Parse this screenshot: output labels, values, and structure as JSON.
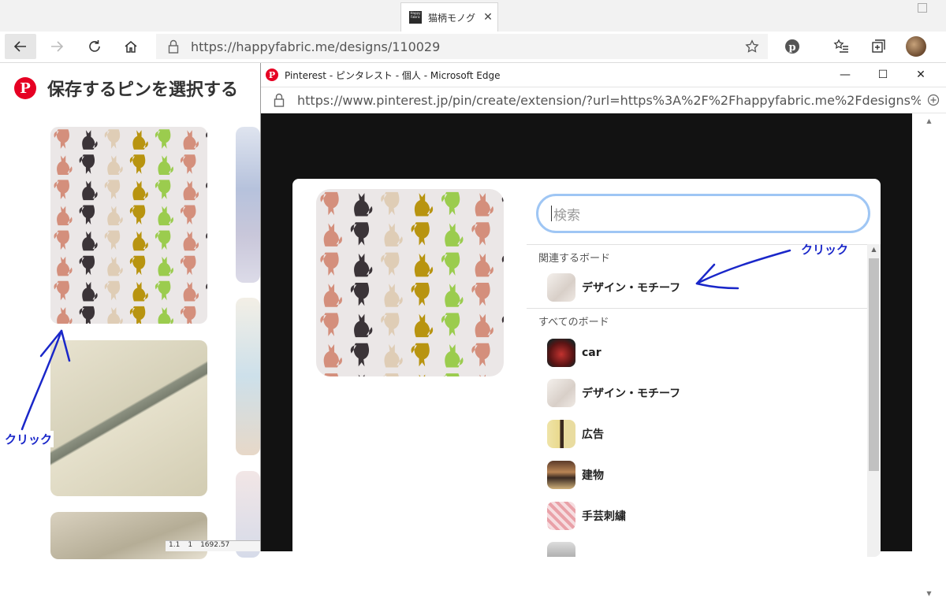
{
  "browser": {
    "tab_title": "猫柄モノグ",
    "tab_favicon_text": "Happy Fabric",
    "address_url": "https://happyfabric.me/designs/110029"
  },
  "background_page": {
    "title": "保存するピンを選択する"
  },
  "popup": {
    "window_title": "Pinterest - ピンタレスト - 個人 - Microsoft Edge",
    "address_url": "https://www.pinterest.jp/pin/create/extension/?url=https%3A%2F%2Fhappyfabric.me%2Fdesigns%2...",
    "search_placeholder": "検索",
    "related_label": "関連するボード",
    "all_label": "すべてのボード",
    "related_boards": [
      {
        "name": "デザイン・モチーフ"
      }
    ],
    "all_boards": [
      {
        "name": "car"
      },
      {
        "name": "デザイン・モチーフ"
      },
      {
        "name": "広告"
      },
      {
        "name": "建物"
      },
      {
        "name": "手芸刺繍"
      }
    ]
  },
  "annotations": {
    "click_left": "クリック",
    "click_right": "クリック",
    "color": "#1a27c9"
  },
  "status_strip": [
    "1.1",
    "1",
    "1692.57"
  ],
  "colors": {
    "pinterest_red": "#e60023",
    "cat_brown": "#d48f7c",
    "cat_green": "#9bcc4e",
    "cat_mustard": "#b89410",
    "cat_beige": "#dfcdb6",
    "cat_dark": "#3b3438"
  }
}
